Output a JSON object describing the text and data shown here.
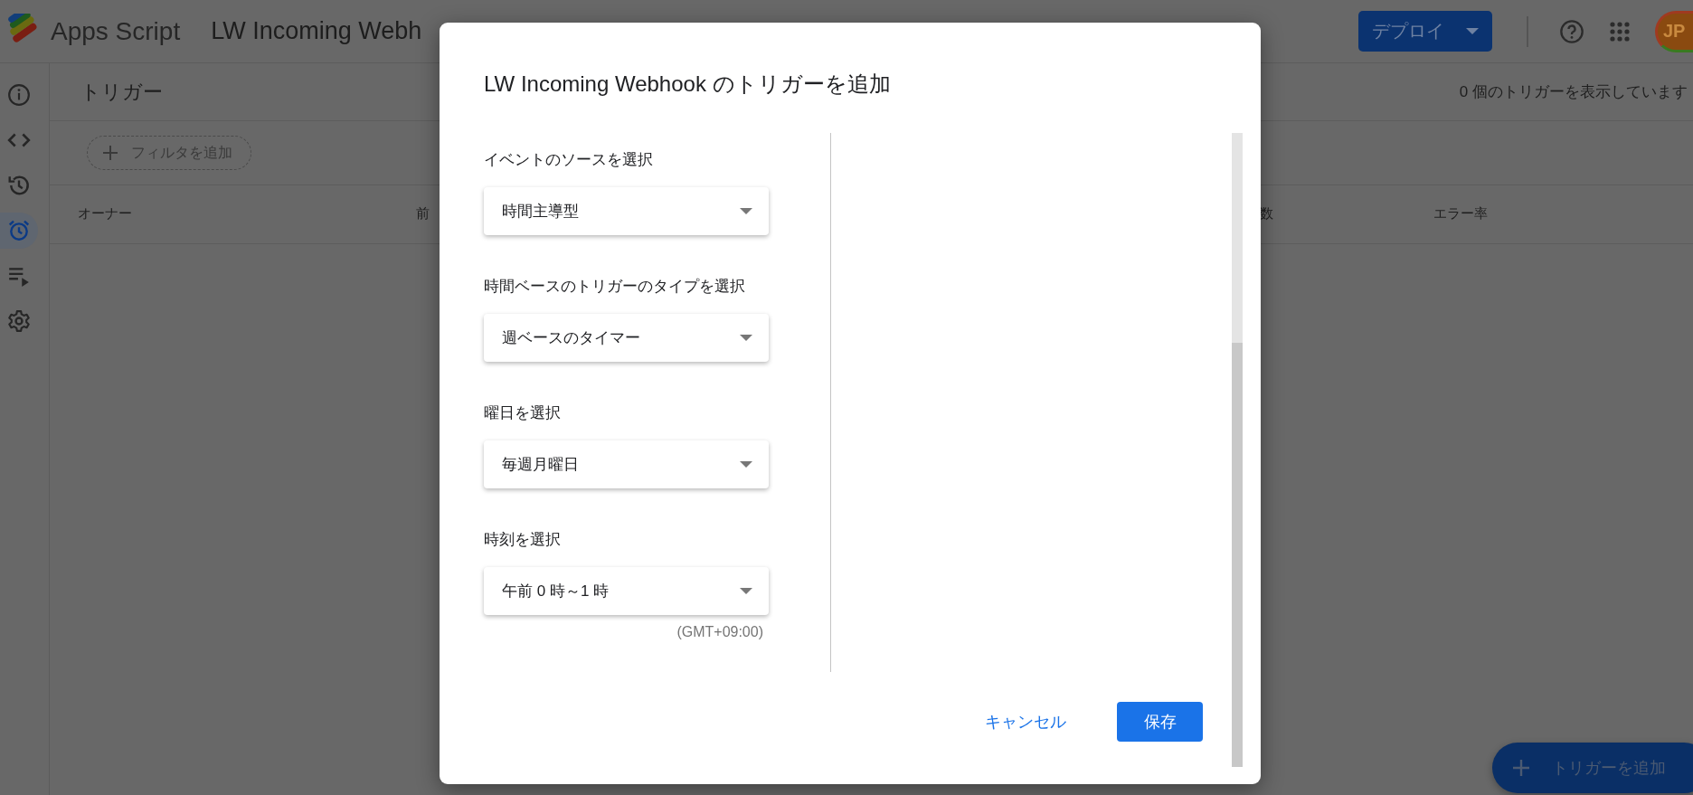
{
  "app": {
    "name": "Apps Script",
    "project_title": "LW Incoming Webh",
    "deploy_button": "デプロイ",
    "avatar_initials": "JP"
  },
  "sidebar": {
    "items": [
      {
        "kind": "info",
        "selected": false
      },
      {
        "kind": "code",
        "selected": false
      },
      {
        "kind": "history",
        "selected": false
      },
      {
        "kind": "alarm",
        "selected": true
      },
      {
        "kind": "runlist",
        "selected": false
      },
      {
        "kind": "settings",
        "selected": false
      }
    ]
  },
  "main": {
    "title": "トリガー",
    "count_text": "0 個のトリガーを表示しています",
    "filter_chip": "フィルタを追加",
    "table": {
      "columns": [
        "オーナー",
        "前",
        "数",
        "エラー率"
      ]
    }
  },
  "dialog": {
    "title": "LW Incoming Webhook のトリガーを追加",
    "fields": [
      {
        "label": "イベントのソースを選択",
        "value": "時間主導型"
      },
      {
        "label": "時間ベースのトリガーのタイプを選択",
        "value": "週ベースのタイマー"
      },
      {
        "label": "曜日を選択",
        "value": "毎週月曜日"
      },
      {
        "label": "時刻を選択",
        "value": "午前 0 時～1 時"
      }
    ],
    "timezone_note": "(GMT+09:00)",
    "cancel_button": "キャンセル",
    "save_button": "保存"
  },
  "fab": {
    "label": "トリガーを追加"
  }
}
